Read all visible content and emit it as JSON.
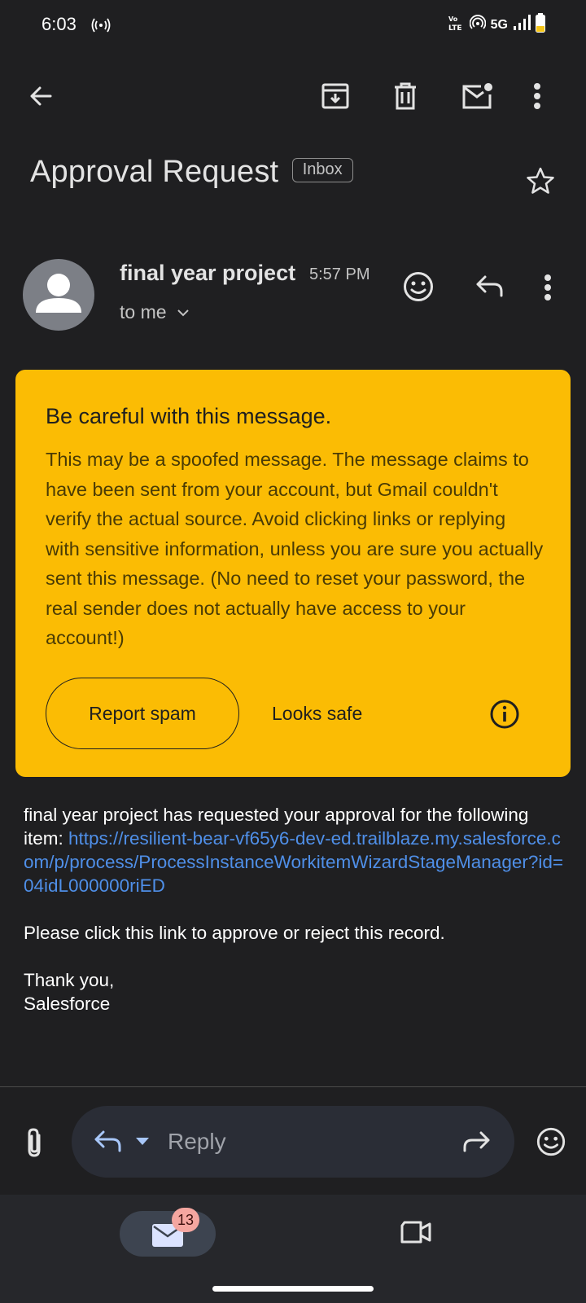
{
  "status_bar": {
    "time": "6:03",
    "network": "5G"
  },
  "toolbar": {
    "icons": [
      "back-arrow-icon",
      "archive-icon",
      "delete-icon",
      "mark-unread-icon",
      "more-vert-icon"
    ]
  },
  "email": {
    "subject": "Approval Request",
    "label": "Inbox",
    "sender": "final year project",
    "time": "5:57 PM",
    "recipient": "to me",
    "body": {
      "intro_text": "final year project has requested your approval for the following item: ",
      "link": "https://resilient-bear-vf65y6-dev-ed.trailblaze.my.salesforce.com/p/process/ProcessInstanceWorkitemWizardStageManager?id=04idL000000riED",
      "instruction": "Please click this link to approve or reject this record.",
      "closing": "Thank you,",
      "signature": "Salesforce"
    }
  },
  "warning": {
    "title": "Be careful with this message.",
    "message": "This may be a spoofed message. The message claims to have been sent from your account, but Gmail couldn't verify the actual source. Avoid clicking links or replying with sensitive information, unless you are sure you actually sent this message. (No need to reset your password, the real sender does not actually have access to your account!)",
    "report_label": "Report spam",
    "safe_label": "Looks safe",
    "color": "#fbbc04"
  },
  "compose": {
    "reply_placeholder": "Reply"
  },
  "bottom_nav": {
    "mail_badge": "13"
  },
  "colors": {
    "background": "#1f1f21",
    "link": "#4f8fe8",
    "avatar": "#7c7f86"
  }
}
